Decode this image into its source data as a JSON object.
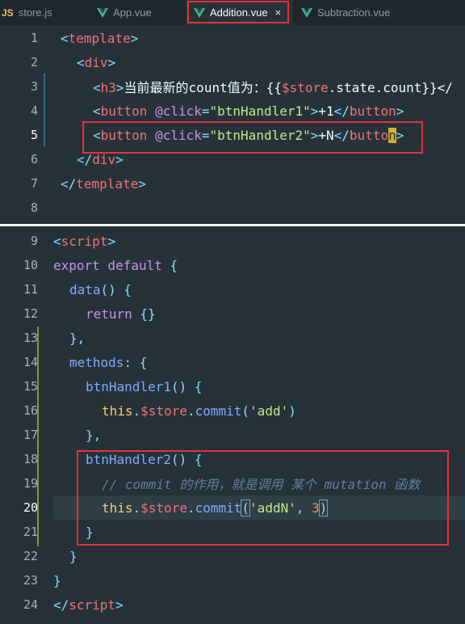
{
  "tabs": [
    {
      "label": "store.js",
      "badge": "JS"
    },
    {
      "label": "App.vue",
      "icon": "vue-icon"
    },
    {
      "label": "Addition.vue",
      "icon": "vue-icon",
      "close": "×"
    },
    {
      "label": "Subtraction.vue",
      "icon": "vue-icon"
    }
  ],
  "template_pane": {
    "line_numbers": [
      "1",
      "2",
      "3",
      "4",
      "5",
      "6",
      "7",
      "8"
    ],
    "lines": {
      "l1": {
        "t1": "<",
        "tag": "template",
        "t2": ">"
      },
      "l2": {
        "t1": "<",
        "tag": "div",
        "t2": ">"
      },
      "l3": {
        "t1": "<",
        "tag": "h3",
        "t2": ">",
        "text": "当前最新的count值为：{{",
        "store": "$store",
        "rest": ".state.count",
        "close": "}}</"
      },
      "l4": {
        "t1": "<",
        "tag": "button",
        "attr": " @click",
        "eq": "=",
        "str": "\"btnHandler1\"",
        "t2": ">",
        "text": "+1",
        "t3": "</",
        "tag2": "button",
        "t4": ">"
      },
      "l5": {
        "t1": "<",
        "tag": "button",
        "attr": " @click",
        "eq": "=",
        "str": "\"btnHandler2\"",
        "t2": ">",
        "text": "+N",
        "t3": "</",
        "tag2a": "butto",
        "cursor": "n",
        "t4": ">"
      },
      "l6": {
        "t1": "</",
        "tag": "div",
        "t2": ">"
      },
      "l7": {
        "t1": "</",
        "tag": "template",
        "t2": ">"
      }
    }
  },
  "script_pane": {
    "line_numbers": [
      "9",
      "10",
      "11",
      "12",
      "13",
      "14",
      "15",
      "16",
      "17",
      "18",
      "19",
      "20",
      "21",
      "22",
      "23",
      "24"
    ],
    "lines": {
      "l9": {
        "t1": "<",
        "tag": "script",
        "t2": ">"
      },
      "l10": {
        "kw1": "export",
        "kw2": " default",
        "br": " {"
      },
      "l11": {
        "fn": "data",
        "p": "()",
        "br": " {"
      },
      "l12": {
        "kw": "return",
        "br": " {}"
      },
      "l13": {
        "br": "},"
      },
      "l14": {
        "prop": "methods",
        "p": ":",
        "br": " {"
      },
      "l15": {
        "fn": "btnHandler1",
        "p": "()",
        "br": " {"
      },
      "l16": {
        "this": "this",
        "dot": ".",
        "var": "$store",
        "dot2": ".",
        "fn": "commit",
        "p1": "(",
        "str": "'add'",
        "p2": ")"
      },
      "l17": {
        "br": "},"
      },
      "l18": {
        "fn": "btnHandler2",
        "p": "()",
        "br": " {"
      },
      "l19": {
        "cmt": "// commit 的作用，就是调用 某个 mutation 函数"
      },
      "l20": {
        "this": "this",
        "dot": ".",
        "var": "$store",
        "dot2": ".",
        "fn": "commit",
        "p1": "(",
        "str": "'addN'",
        "comma": ", ",
        "num": "3",
        "p2": ")"
      },
      "l21": {
        "br": "}"
      },
      "l22": {
        "br": "}"
      },
      "l23": {
        "br": "}"
      },
      "l24": {
        "t1": "</",
        "tag": "script",
        "t2": ">"
      }
    }
  }
}
